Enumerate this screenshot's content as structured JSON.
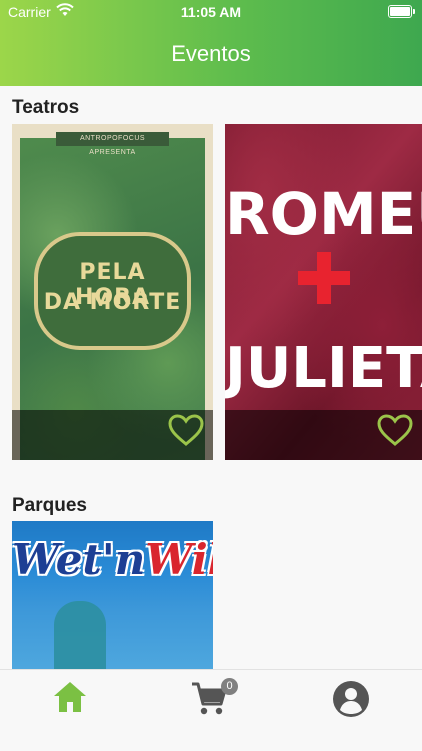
{
  "status_bar": {
    "carrier": "Carrier",
    "time": "11:05 AM"
  },
  "header": {
    "title": "Eventos"
  },
  "sections": [
    {
      "title": "Teatros",
      "cards": [
        {
          "poster_top": "ANTROPOFOCUS APRESENTA",
          "poster_title_line1": "PELA HORA",
          "poster_title_line2": "DA MORTE",
          "favorited": false
        },
        {
          "poster_title_line1": "ROMEU",
          "poster_title_line2": "JULIETA",
          "favorited": false
        }
      ]
    },
    {
      "title": "Parques",
      "cards": [
        {
          "logo_part1": "Wet'n",
          "logo_part2": "Wild"
        }
      ]
    }
  ],
  "tabbar": {
    "items": [
      {
        "icon": "home-icon",
        "active": true
      },
      {
        "icon": "cart-icon",
        "badge": "0",
        "active": false
      },
      {
        "icon": "user-icon",
        "active": false
      }
    ]
  },
  "colors": {
    "accent": "#5fbd4d",
    "heart": "#9bc44a",
    "tab_active": "#7bc043",
    "tab_inactive": "#555555"
  }
}
